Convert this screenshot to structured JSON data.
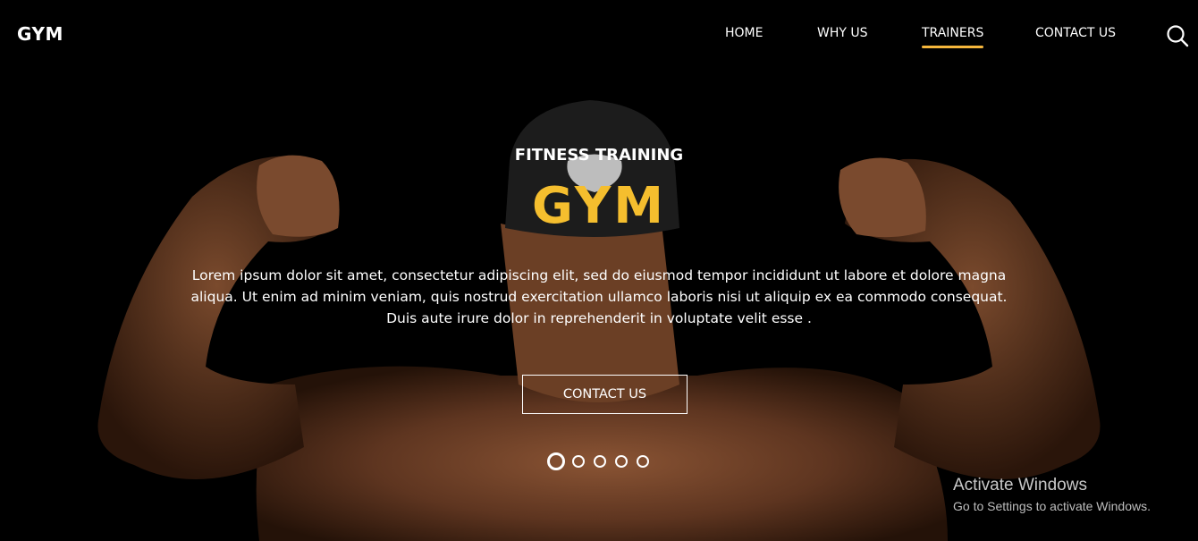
{
  "header": {
    "logo": "GYM",
    "nav": [
      {
        "label": "HOME",
        "active": false
      },
      {
        "label": "WHY US",
        "active": false
      },
      {
        "label": "TRAINERS",
        "active": true
      },
      {
        "label": "CONTACT US",
        "active": false
      }
    ],
    "search_icon": "search-icon"
  },
  "hero": {
    "subtitle": "FITNESS TRAINING",
    "title": "GYM",
    "description": "Lorem ipsum dolor sit amet, consectetur adipiscing elit, sed do eiusmod tempor incididunt ut labore et dolore magna aliqua. Ut enim ad minim veniam, quis nostrud exercitation ullamco laboris nisi ut aliquip ex ea commodo consequat. Duis aute irure dolor in reprehenderit in voluptate velit esse .",
    "cta_label": "CONTACT US",
    "slides_total": 5,
    "slide_active": 1
  },
  "watermark": {
    "line1": "Activate Windows",
    "line2": "Go to Settings to activate Windows."
  },
  "colors": {
    "accent": "#f5be2e",
    "underline": "#f5b63c",
    "background": "#000000"
  }
}
